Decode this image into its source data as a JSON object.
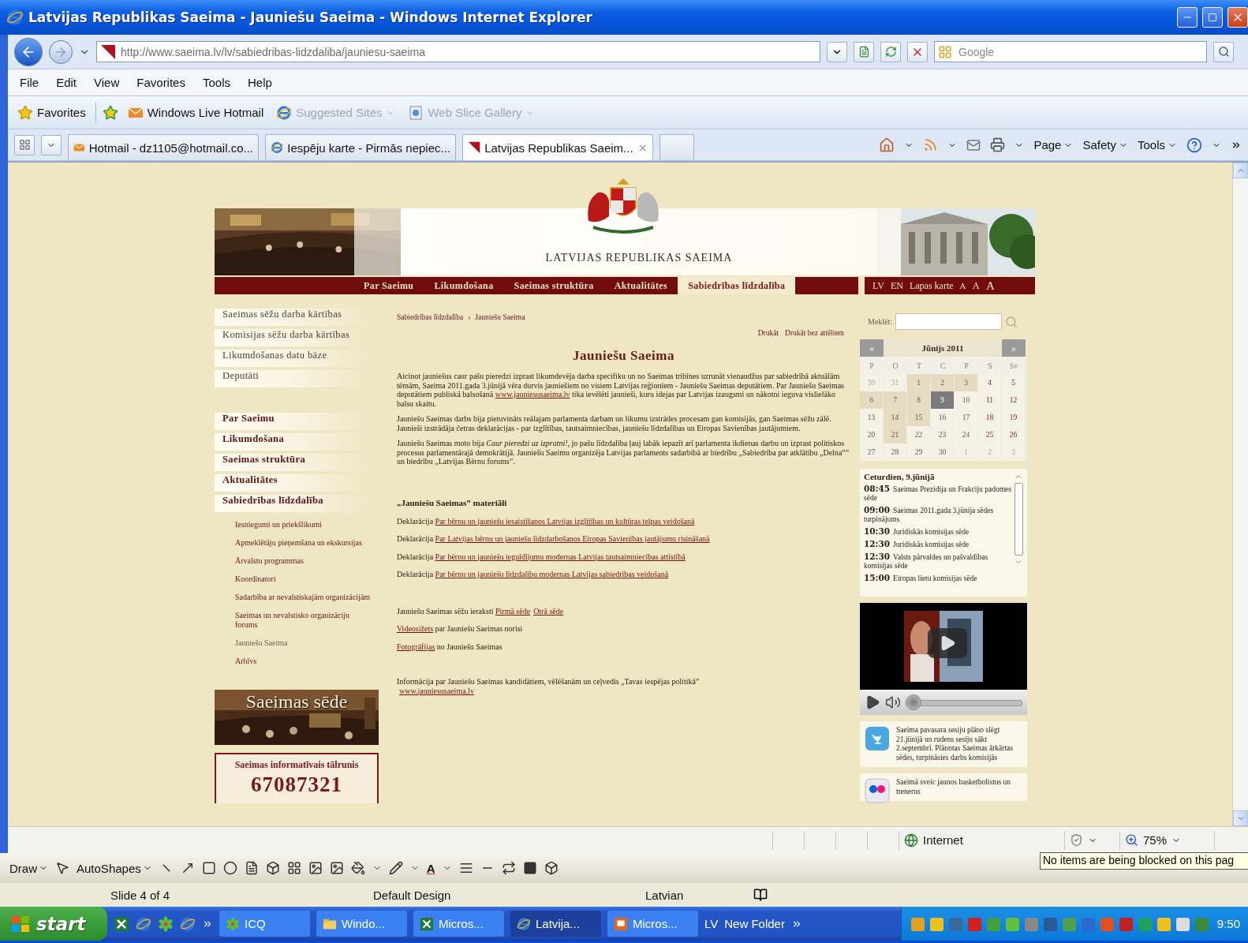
{
  "window": {
    "title": "Latvijas Republikas Saeima - Jauniešu Saeima - Windows Internet Explorer"
  },
  "address_bar": {
    "url": "http://www.saeima.lv/lv/sabiedribas-lidzdaliba/jauniesu-saeima",
    "search_placeholder": "Google"
  },
  "menu": [
    "File",
    "Edit",
    "View",
    "Favorites",
    "Tools",
    "Help"
  ],
  "favorites_bar": [
    {
      "label": "Favorites",
      "kind": "star",
      "disabled": false,
      "dropdown": false
    },
    {
      "label": "Windows Live Hotmail",
      "kind": "mail",
      "disabled": false,
      "dropdown": false
    },
    {
      "label": "Suggested Sites",
      "kind": "ie",
      "disabled": true,
      "dropdown": true
    },
    {
      "label": "Web Slice Gallery",
      "kind": "slice",
      "disabled": true,
      "dropdown": true
    }
  ],
  "tabs": [
    {
      "label": "Hotmail - dz1105@hotmail.co...",
      "selected": false
    },
    {
      "label": "Iespēju karte - Pirmās nepiec...",
      "selected": false
    },
    {
      "label": "Latvijas Republikas Saeim...",
      "selected": true
    }
  ],
  "command_bar": [
    "Page",
    "Safety",
    "Tools"
  ],
  "site": {
    "title": "LATVIJAS REPUBLIKAS SAEIMA",
    "nav": [
      {
        "label": "Par Saeimu",
        "selected": false
      },
      {
        "label": "Likumdošana",
        "selected": false
      },
      {
        "label": "Saeimas struktūra",
        "selected": false
      },
      {
        "label": "Aktualitātes",
        "selected": false
      },
      {
        "label": "Sabiedrības līdzdalība",
        "selected": true
      }
    ],
    "languages": [
      "LV",
      "EN"
    ],
    "sitemap": "Lapas karte",
    "text_sizes": [
      "A",
      "A",
      "A"
    ]
  },
  "left_menu": {
    "quick_links": [
      "Saeimas sēžu darba kārtības",
      "Komisijas sēžu darba kārtības",
      "Likumdošanas datu bāze",
      "Deputāti"
    ],
    "sections": [
      {
        "label": "Par Saeimu"
      },
      {
        "label": "Likumdošana"
      },
      {
        "label": "Saeimas struktūra"
      },
      {
        "label": "Aktualitātes"
      },
      {
        "label": "Sabiedrības līdzdalība",
        "children": [
          {
            "label": "Iesniegumi un priekšlikumi",
            "selected": false
          },
          {
            "label": "Apmeklētāju pieņemšana un ekskursijas",
            "selected": false
          },
          {
            "label": "Ārvalstu programmas",
            "selected": false
          },
          {
            "label": "Koordinatori",
            "selected": false
          },
          {
            "label": "Sadarbība ar nevalstiskajām organizācijām",
            "selected": false
          },
          {
            "label": "Saeimas un nevalstisko organizāciju forums",
            "selected": false
          },
          {
            "label": "Jauniešu Saeima",
            "selected": true
          },
          {
            "label": "Arhīvs",
            "selected": false
          }
        ]
      }
    ]
  },
  "banner": {
    "caption": "Saeimas sēde"
  },
  "hotline": {
    "title": "Saeimas informatīvais tālrunis",
    "number": "67087321"
  },
  "breadcrumb": {
    "items": [
      "Sabiedrības līdzdalība",
      "Jauniešu Saeima"
    ],
    "separator": "›"
  },
  "print_links": [
    "Drukāt",
    "Drukāt bez attēliem"
  ],
  "article": {
    "title": "Jauniešu Saeima",
    "paragraphs": [
      [
        {
          "kind": "text",
          "text": "Aicinot jauniešus caur pašu pieredzi izprast likumdevēja darba specifiku un no Saeimas tribīnes uzrunāt vienaudžus par sabiedrībā aktuālām tēmām, Saeima 2011.gada 3.jūnijā vēra durvis jauniešiem no visiem Latvijas reģioniem - Jauniešu Saeimas deputātiem. Par Jauniešu Saeimas deputātiem publiskā balsošanā "
        },
        {
          "kind": "link",
          "text": "www.jauniesusaeima.lv"
        },
        {
          "kind": "text",
          "text": " tika ievēlēti jaunieši, kuru idejas par Latvijas izaugsmi un nākotni ieguva vislielāko balsu skaitu."
        }
      ],
      [
        {
          "kind": "text",
          "text": "Jauniešu Saeimas darbs bija pietuvināts reālajam parlamenta darbam un likumu izstrādes procesam gan komisijās, gan Saeimas sēžu zālē. Jaunieši izstrādāja četras deklarācijas - par izglītības, tautsaimniecības, jauniešu līdzdalības un Eiropas Savienības jautājumiem."
        }
      ],
      [
        {
          "kind": "text",
          "text": "Jauniešu Saeimas moto bija *Caur pieredzi uz izpratni!*, jo pašu līdzdalība ļauj labāk iepazīt arī parlamenta ikdienas darbu un izprast politiskos procesus parlamentārajā demokrātijā. Jauniešu Saeimu organizēja Latvijas parlaments sadarbībā ar biedrību „Sabiedrība par atklātību „Delna”” un biedrību „Latvijas Bērnu forums”."
        }
      ]
    ],
    "materials_title": "„Jauniešu Saeimas” materiāli",
    "declarations": [
      [
        {
          "kind": "text",
          "text": "Deklarācija "
        },
        {
          "kind": "link",
          "text": "Par bērnu un jauniešu iesaistīšanos Latvijas izglītības un kultūras telpas veidošanā"
        }
      ],
      [
        {
          "kind": "text",
          "text": "Deklarācija "
        },
        {
          "kind": "link",
          "text": "Par Latvijas bērnu un jauniešu līdzdarbošanos Eiropas Savienības jautājumu risināšanā"
        }
      ],
      [
        {
          "kind": "text",
          "text": "Deklarācija "
        },
        {
          "kind": "link",
          "text": "Par bērnu un jauniešu ieguldījumu modernas Latvijas tautsaimniecības attīstībā"
        }
      ],
      [
        {
          "kind": "text",
          "text": "Deklarācija "
        },
        {
          "kind": "link",
          "text": "Par bērnu un jauniešu līdzdalību modernas  Latvijas sabiedrības veidošanā"
        }
      ]
    ],
    "media": [
      [
        {
          "kind": "text",
          "text": "Jauniešu Saeimas sēžu ieraksti "
        },
        {
          "kind": "link",
          "text": "Pirmā sēde"
        },
        {
          "kind": "link",
          "text": "Otrā sēde"
        }
      ],
      [
        {
          "kind": "link",
          "text": "Videosižets"
        },
        {
          "kind": "text",
          "text": " par Jauniešu Saeimas norisi"
        }
      ],
      [
        {
          "kind": "link",
          "text": "Fotogrāfijas"
        },
        {
          "kind": "text",
          "text": " no Jauniešu Saeimas"
        }
      ]
    ],
    "info": {
      "text": "Informācija par Jauniešu Saeimas kandidātiem, vēlēšanām un ceļvedis „Tavas iespējas politikā”",
      "link": "www.jauniesusaeima.lv"
    }
  },
  "search": {
    "label": "Meklēt:"
  },
  "calendar": {
    "month": "Jūnijs 2011",
    "prev": "«",
    "next": "»",
    "weekdays": [
      "P",
      "O",
      "T",
      "C",
      "P",
      "S",
      "Sv"
    ],
    "weeks": [
      [
        {
          "day": "30",
          "kind": "other",
          "events": false,
          "selected": false
        },
        {
          "day": "31",
          "kind": "other",
          "events": false,
          "selected": false
        },
        {
          "day": "1",
          "kind": "weekday",
          "events": true,
          "selected": false
        },
        {
          "day": "2",
          "kind": "weekday",
          "events": true,
          "selected": false
        },
        {
          "day": "3",
          "kind": "weekday",
          "events": true,
          "selected": false
        },
        {
          "day": "4",
          "kind": "weekend",
          "events": false,
          "selected": false
        },
        {
          "day": "5",
          "kind": "weekend",
          "events": false,
          "selected": false
        }
      ],
      [
        {
          "day": "6",
          "kind": "weekday",
          "events": true,
          "selected": false
        },
        {
          "day": "7",
          "kind": "weekday",
          "events": true,
          "selected": false
        },
        {
          "day": "8",
          "kind": "weekday",
          "events": true,
          "selected": false
        },
        {
          "day": "9",
          "kind": "weekday",
          "events": true,
          "selected": true
        },
        {
          "day": "10",
          "kind": "weekday",
          "events": false,
          "selected": false
        },
        {
          "day": "11",
          "kind": "weekend",
          "events": false,
          "selected": false
        },
        {
          "day": "12",
          "kind": "weekend",
          "events": false,
          "selected": false
        }
      ],
      [
        {
          "day": "13",
          "kind": "weekday",
          "events": false,
          "selected": false
        },
        {
          "day": "14",
          "kind": "weekday",
          "events": true,
          "selected": false
        },
        {
          "day": "15",
          "kind": "weekday",
          "events": true,
          "selected": false
        },
        {
          "day": "16",
          "kind": "weekday",
          "events": false,
          "selected": false
        },
        {
          "day": "17",
          "kind": "weekday",
          "events": false,
          "selected": false
        },
        {
          "day": "18",
          "kind": "weekend",
          "events": false,
          "selected": false
        },
        {
          "day": "19",
          "kind": "weekend",
          "events": false,
          "selected": false
        }
      ],
      [
        {
          "day": "20",
          "kind": "weekday",
          "events": false,
          "selected": false
        },
        {
          "day": "21",
          "kind": "weekday",
          "events": true,
          "selected": false
        },
        {
          "day": "22",
          "kind": "weekday",
          "events": false,
          "selected": false
        },
        {
          "day": "23",
          "kind": "weekday",
          "events": false,
          "selected": false
        },
        {
          "day": "24",
          "kind": "weekday",
          "events": false,
          "selected": false
        },
        {
          "day": "25",
          "kind": "weekend",
          "events": false,
          "selected": false
        },
        {
          "day": "26",
          "kind": "weekend",
          "events": false,
          "selected": false
        }
      ],
      [
        {
          "day": "27",
          "kind": "weekday",
          "events": false,
          "selected": false
        },
        {
          "day": "28",
          "kind": "weekday",
          "events": false,
          "selected": false
        },
        {
          "day": "29",
          "kind": "weekday",
          "events": false,
          "selected": false
        },
        {
          "day": "30",
          "kind": "weekday",
          "events": false,
          "selected": false
        },
        {
          "day": "1",
          "kind": "other",
          "events": false,
          "selected": false
        },
        {
          "day": "2",
          "kind": "other",
          "events": false,
          "selected": false
        },
        {
          "day": "3",
          "kind": "other",
          "events": false,
          "selected": false
        }
      ]
    ]
  },
  "events": {
    "date": "Ceturdien, 9.jūnijā",
    "items": [
      {
        "time": "08:45",
        "title": "Saeimas Prezidija un Frakciju padomes sēde"
      },
      {
        "time": "09:00",
        "title": "Saeimas 2011.gada 3.jūnija sēdes turpinājums"
      },
      {
        "time": "10:30",
        "title": "Juridiskās komisijas sēde"
      },
      {
        "time": "12:30",
        "title": "Juridiskās komisijas sēde"
      },
      {
        "time": "12:30",
        "title": "Valsts pārvaldes un pašvaldības komisijas sēde"
      },
      {
        "time": "15:00",
        "title": "Eiropas lietu komisijas sēde"
      }
    ]
  },
  "video": {
    "level": 0
  },
  "news": [
    {
      "text": "Saeima pavasara sesiju plāno slēgt 21.jūnijā un rudens sesiju sākt 2.septembrī. Plānotas Saeimas ārkārtas sēdes, turpināsies darbs komisijās"
    },
    {
      "text": "Saeimā sveic jaunos basketbolistus un trenerus"
    }
  ],
  "status_bar": {
    "zone": "Internet",
    "zoom": "75%",
    "tooltip": "No items are being blocked on this pag"
  },
  "powerpoint": {
    "draw": "Draw",
    "autoshapes": "AutoShapes",
    "font_color": "A",
    "status": [
      "Slide 4 of 4",
      "Default Design",
      "Latvian"
    ]
  },
  "taskbar": {
    "start": "start",
    "items": [
      {
        "label": "ICQ",
        "selected": false
      },
      {
        "label": "Windo...",
        "selected": false
      },
      {
        "label": "Micros...",
        "selected": false
      },
      {
        "label": "Latvija...",
        "selected": true
      },
      {
        "label": "Micros...",
        "selected": false
      }
    ],
    "language": "LV",
    "folder": "New Folder",
    "clock": "9:50"
  }
}
